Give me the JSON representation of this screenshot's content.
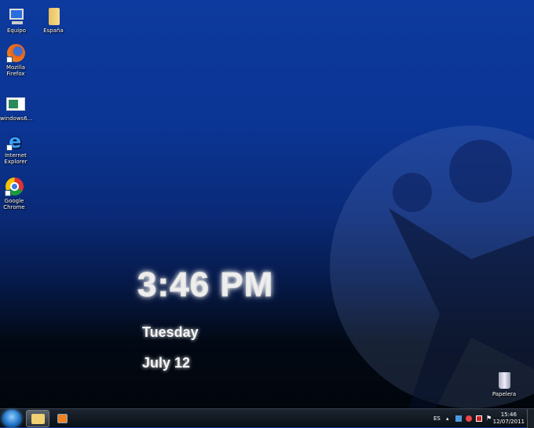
{
  "desktop_icons": [
    {
      "label": "Equipo",
      "icon": "computer-icon"
    },
    {
      "label": "España",
      "icon": "folder-icon"
    },
    {
      "label": "Mozilla Firefox",
      "icon": "firefox-icon"
    },
    {
      "label": "windows6...",
      "icon": "image-file-icon"
    },
    {
      "label": "Internet Explorer",
      "icon": "internet-explorer-icon"
    },
    {
      "label": "Google Chrome",
      "icon": "chrome-icon"
    },
    {
      "label": "Papelera",
      "icon": "recycle-bin-icon"
    }
  ],
  "gadget": {
    "time": "3:46 PM",
    "day": "Tuesday",
    "date": "July 12"
  },
  "taskbar": {
    "language": "ES",
    "tray_time": "15:46",
    "tray_date": "12/07/2011"
  }
}
